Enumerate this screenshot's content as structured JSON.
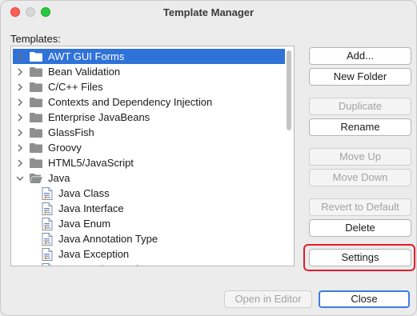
{
  "window": {
    "title": "Template Manager"
  },
  "tree": {
    "label": "Templates:",
    "items": [
      {
        "label": "AWT GUI Forms",
        "kind": "folder",
        "expanded": false,
        "selected": true
      },
      {
        "label": "Bean Validation",
        "kind": "folder",
        "expanded": false
      },
      {
        "label": "C/C++ Files",
        "kind": "folder",
        "expanded": false
      },
      {
        "label": "Contexts and Dependency Injection",
        "kind": "folder",
        "expanded": false
      },
      {
        "label": "Enterprise JavaBeans",
        "kind": "folder",
        "expanded": false
      },
      {
        "label": "GlassFish",
        "kind": "folder",
        "expanded": false
      },
      {
        "label": "Groovy",
        "kind": "folder",
        "expanded": false
      },
      {
        "label": "HTML5/JavaScript",
        "kind": "folder",
        "expanded": false
      },
      {
        "label": "Java",
        "kind": "folder",
        "expanded": true
      },
      {
        "label": "Java Class",
        "kind": "file"
      },
      {
        "label": "Java Interface",
        "kind": "file"
      },
      {
        "label": "Java Enum",
        "kind": "file"
      },
      {
        "label": "Java Annotation Type",
        "kind": "file"
      },
      {
        "label": "Java Exception",
        "kind": "file"
      },
      {
        "label": "Java Package Info",
        "kind": "file"
      }
    ]
  },
  "buttons": {
    "add": "Add...",
    "new_folder": "New Folder",
    "duplicate": "Duplicate",
    "rename": "Rename",
    "move_up": "Move Up",
    "move_down": "Move Down",
    "revert": "Revert to Default",
    "delete": "Delete",
    "settings": "Settings",
    "open_in_editor": "Open in Editor",
    "close": "Close"
  },
  "colors": {
    "selection": "#2f72d8",
    "highlight": "#e21b2d",
    "primary_border": "#3d7be0"
  }
}
